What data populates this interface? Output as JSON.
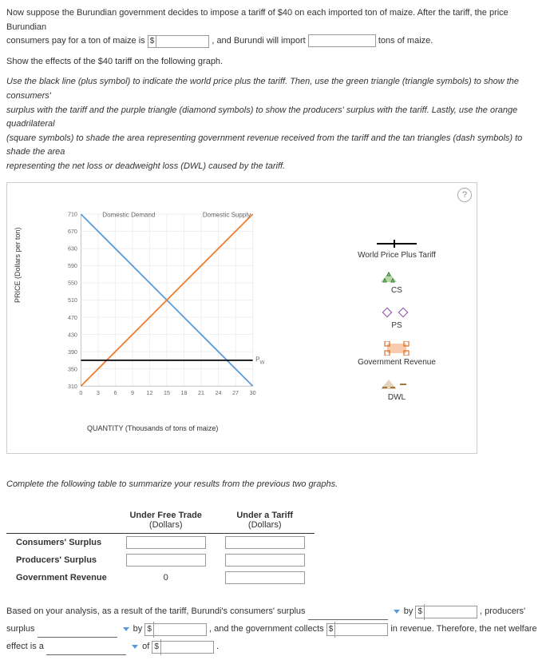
{
  "intro": {
    "line1a": "Now suppose the Burundian government decides to impose a tariff of $40 on each imported ton of maize. After the tariff, the price Burundian",
    "line1b": "consumers pay for a ton of maize is",
    "line1c": ", and Burundi will import",
    "line1d": "tons of maize.",
    "line2": "Show the effects of the $40 tariff on the following graph."
  },
  "instructions": {
    "l1": "Use the black line (plus symbol) to indicate the world price plus the tariff. Then, use the green triangle (triangle symbols) to show the consumers'",
    "l2": "surplus with the tariff and the purple triangle (diamond symbols) to show the producers' surplus with the tariff. Lastly, use the orange quadrilateral",
    "l3": "(square symbols) to shade the area representing government revenue received from the tariff and the tan triangles (dash symbols) to shade the area",
    "l4": "representing the net loss or deadweight loss (DWL) caused by the tariff."
  },
  "chart": {
    "y_label": "PRICE (Dollars per ton)",
    "x_label": "QUANTITY (Thousands of tons of maize)",
    "demand_label": "Domestic Demand",
    "supply_label": "Domestic Supply",
    "pw_label": "P",
    "pw_sub": "W",
    "help": "?",
    "y_ticks": [
      "310",
      "350",
      "390",
      "430",
      "470",
      "510",
      "550",
      "590",
      "630",
      "670",
      "710"
    ],
    "x_ticks": [
      "0",
      "3",
      "6",
      "9",
      "12",
      "15",
      "18",
      "21",
      "24",
      "27",
      "30"
    ]
  },
  "chart_data": {
    "type": "line",
    "xlabel": "QUANTITY (Thousands of tons of maize)",
    "ylabel": "PRICE (Dollars per ton)",
    "xlim": [
      0,
      30
    ],
    "ylim": [
      310,
      710
    ],
    "series": [
      {
        "name": "Domestic Demand",
        "color": "#5b9bd5",
        "points": [
          [
            0,
            710
          ],
          [
            30,
            310
          ]
        ]
      },
      {
        "name": "Domestic Supply",
        "color": "#ed7d31",
        "points": [
          [
            0,
            310
          ],
          [
            30,
            710
          ]
        ]
      },
      {
        "name": "Pw",
        "color": "#000000",
        "points": [
          [
            0,
            370
          ],
          [
            30,
            370
          ]
        ]
      }
    ]
  },
  "legend": {
    "wpt": "World Price Plus Tariff",
    "cs": "CS",
    "ps": "PS",
    "gr": "Government Revenue",
    "dwl": "DWL"
  },
  "table": {
    "prompt": "Complete the following table to summarize your results from the previous two graphs.",
    "h1": "Under Free Trade",
    "h2": "Under a Tariff",
    "unit": "(Dollars)",
    "r1": "Consumers' Surplus",
    "r2": "Producers' Surplus",
    "r3": "Government Revenue",
    "zero": "0"
  },
  "conclusion": {
    "a": "Based on your analysis, as a result of the tariff, Burundi's consumers' surplus",
    "b": "by",
    "c": ", producers' surplus",
    "d": "by",
    "e": ", and the government collects",
    "f": "in revenue. Therefore, the net welfare effect is a",
    "g": "of",
    "h": "."
  }
}
